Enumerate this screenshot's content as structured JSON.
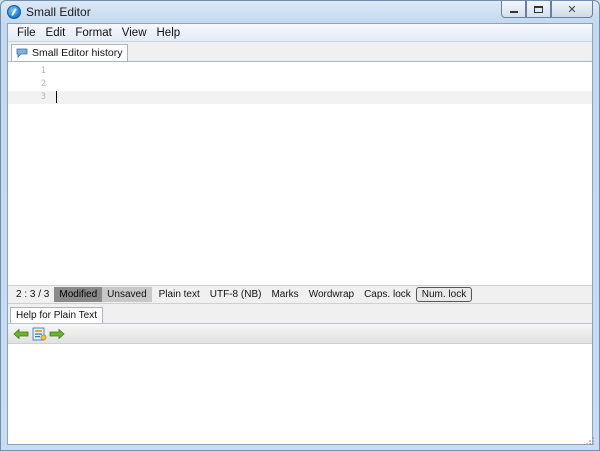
{
  "window": {
    "title": "Small Editor",
    "icon": "app-pen-icon",
    "controls": {
      "minimize": "",
      "maximize": "",
      "close": "✕"
    }
  },
  "menu": [
    "File",
    "Edit",
    "Format",
    "View",
    "Help"
  ],
  "document_tab": {
    "label": "Small Editor history",
    "icon": "speech-bubble-icon"
  },
  "editor": {
    "lines": [
      "1",
      "2",
      "3"
    ],
    "current_line": 3
  },
  "status": {
    "position": "2 : 3 / 3",
    "modified": "Modified",
    "unsaved": "Unsaved",
    "mode": "Plain text",
    "encoding": "UTF-8 (NB)",
    "marks": "Marks",
    "wordwrap": "Wordwrap",
    "caps_lock": "Caps. lock",
    "num_lock": "Num. lock"
  },
  "help_panel": {
    "tab_label": "Help for Plain Text",
    "toolbar": [
      "back-arrow-icon",
      "home-page-icon",
      "forward-arrow-icon"
    ]
  },
  "colors": {
    "accent": "#1c78d0",
    "modified_bg": "#8a8a8a",
    "unsaved_bg": "#c8c8c8",
    "arrow_green": "#6fb52c"
  }
}
